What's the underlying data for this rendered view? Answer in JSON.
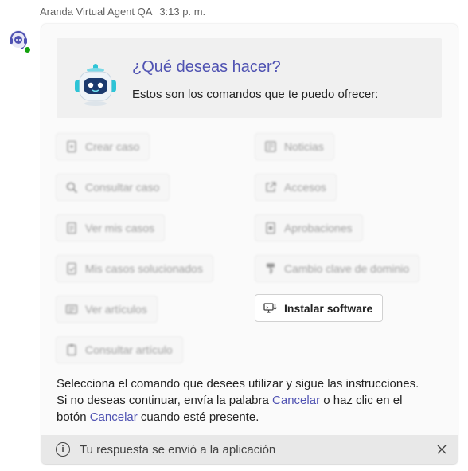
{
  "message": {
    "sender": "Aranda Virtual Agent QA",
    "time": "3:13 p. m."
  },
  "card": {
    "title": "¿Qué deseas hacer?",
    "subtitle": "Estos son los comandos que te puedo ofrecer:",
    "commands_left": [
      {
        "label": "Crear caso",
        "icon": "document-add-icon"
      },
      {
        "label": "Consultar caso",
        "icon": "search-icon"
      },
      {
        "label": "Ver mis casos",
        "icon": "document-list-icon"
      },
      {
        "label": "Mis casos solucionados",
        "icon": "document-check-icon"
      },
      {
        "label": "Ver artículos",
        "icon": "article-icon"
      },
      {
        "label": "Consultar artículo",
        "icon": "clipboard-icon"
      }
    ],
    "commands_right": [
      {
        "label": "Noticias",
        "icon": "news-icon"
      },
      {
        "label": "Accesos",
        "icon": "open-external-icon"
      },
      {
        "label": "Aprobaciones",
        "icon": "approval-document-icon"
      },
      {
        "label": "Cambio clave de dominio",
        "icon": "key-icon"
      },
      {
        "label": "Instalar software",
        "icon": "install-software-icon"
      }
    ],
    "instructions": {
      "line1": "Selecciona el comando que desees utilizar y sigue las instrucciones.",
      "line2_a": "Si no deseas continuar, envía la palabra ",
      "link1": "Cancelar",
      "line2_b": " o haz clic en el",
      "line3_a": "botón ",
      "link2": "Cancelar",
      "line3_b": " cuando esté presente."
    },
    "footer": {
      "text": "Tu respuesta se envió a la aplicación",
      "info_icon": "info-icon",
      "close_icon": "close-icon"
    }
  },
  "colors": {
    "accent": "#4f52b2",
    "card_background": "#fafafa",
    "hero_background": "#f0f0f0",
    "footer_background": "#e8e8e8",
    "status_online": "#13a10e"
  }
}
